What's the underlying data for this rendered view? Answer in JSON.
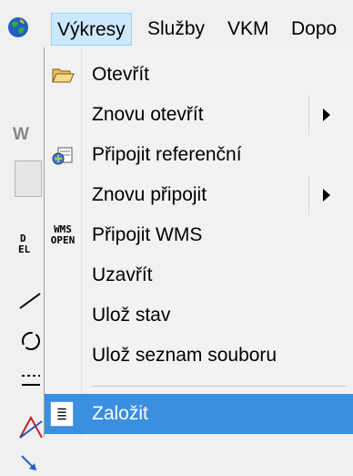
{
  "menubar": {
    "items": [
      {
        "label": "Výkresy",
        "active": true
      },
      {
        "label": "Služby"
      },
      {
        "label": "VKM"
      },
      {
        "label": "Dopo"
      }
    ]
  },
  "left_strip": {
    "text": "W",
    "tool_icons": [
      "del-icon",
      "line-icon",
      "circle-icon",
      "dimension-icon",
      "triangle-icon",
      "arrow-icon"
    ]
  },
  "dropdown": {
    "items": [
      {
        "label": "Otevřít",
        "icon": "open-folder-icon"
      },
      {
        "label": "Znovu otevřít",
        "submenu": true
      },
      {
        "label": "Připojit referenční",
        "icon": "attach-reference-icon"
      },
      {
        "label": "Znovu připojit",
        "submenu": true
      },
      {
        "label": "Připojit WMS",
        "icon": "wms-icon",
        "icon_text": "WMS OPEN"
      },
      {
        "label": "Uzavřít"
      },
      {
        "label": "Ulož stav"
      },
      {
        "label": "Ulož seznam souboru"
      },
      {
        "label": "Založit",
        "icon": "document-icon",
        "highlighted": true
      }
    ]
  },
  "colors": {
    "highlight": "#3a8fe0",
    "menu_active": "#cce8ff",
    "background": "#f0f0f0"
  }
}
